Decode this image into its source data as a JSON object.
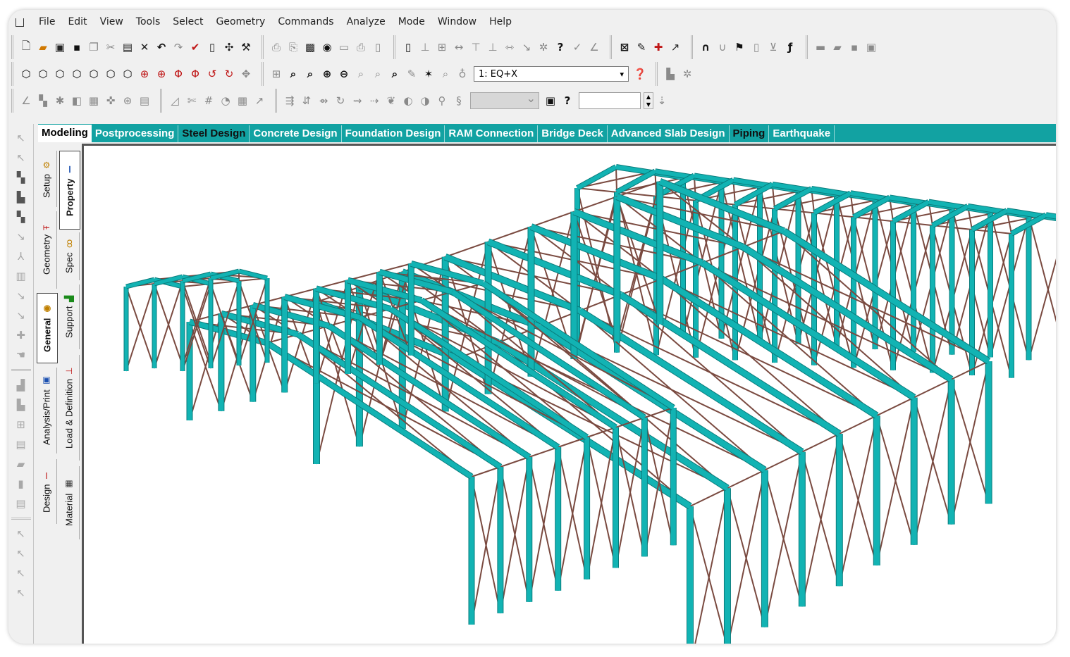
{
  "menu": {
    "items": [
      "File",
      "Edit",
      "View",
      "Tools",
      "Select",
      "Geometry",
      "Commands",
      "Analyze",
      "Mode",
      "Window",
      "Help"
    ]
  },
  "toolbar": {
    "load_case_value": "1: EQ+X"
  },
  "tabs": [
    {
      "label": "Modeling",
      "active": true
    },
    {
      "label": "Postprocessing"
    },
    {
      "label": "Steel Design",
      "dark": true
    },
    {
      "label": "Concrete Design"
    },
    {
      "label": "Foundation Design"
    },
    {
      "label": "RAM Connection"
    },
    {
      "label": "Bridge Deck"
    },
    {
      "label": "Advanced Slab Design"
    },
    {
      "label": "Piping",
      "dark": true
    },
    {
      "label": "Earthquake"
    }
  ],
  "vertical_tabs": {
    "column1": [
      "Setup",
      "Geometry",
      "General",
      "Analysis/Print",
      "Design"
    ],
    "column2": [
      "Property",
      "Spec",
      "Support",
      "Load & Definition",
      "Material"
    ]
  },
  "colors": {
    "accent": "#12a2a2",
    "member": "#12b3b3",
    "member_edge": "#0a7c7c",
    "bracing": "#7a4a40"
  }
}
